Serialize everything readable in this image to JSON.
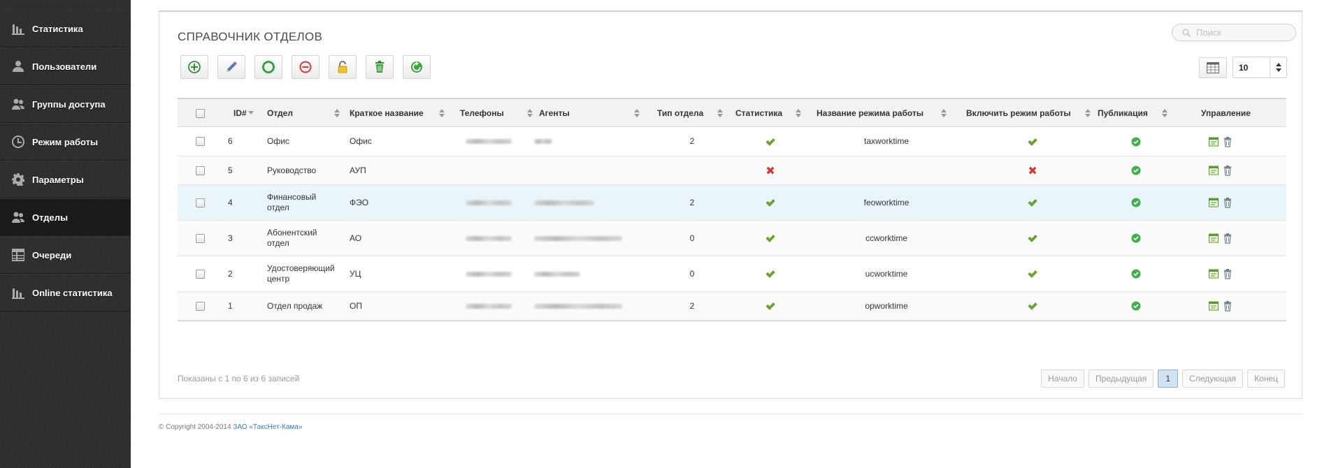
{
  "sidebar": {
    "items": [
      {
        "label": "Статистика",
        "icon": "bar-chart-icon"
      },
      {
        "label": "Пользователи",
        "icon": "user-icon"
      },
      {
        "label": "Группы доступа",
        "icon": "users-group-icon"
      },
      {
        "label": "Режим работы",
        "icon": "clock-icon"
      },
      {
        "label": "Параметры",
        "icon": "gear-icon"
      },
      {
        "label": "Отделы",
        "icon": "users-group-icon",
        "active": true
      },
      {
        "label": "Очереди",
        "icon": "table-icon"
      },
      {
        "label": "Online статистика",
        "icon": "bar-chart-icon"
      }
    ]
  },
  "main": {
    "title": "СПРАВОЧНИК ОТДЕЛОВ",
    "search_placeholder": "Поиск",
    "page_size": "10",
    "toolbar": [
      "add-circle-icon",
      "pencil-icon",
      "enable-circle-icon",
      "disable-circle-icon",
      "lock-icon",
      "trash-icon",
      "refresh-icon"
    ],
    "columns": {
      "id": "ID#",
      "dept": "Отдел",
      "short": "Краткое название",
      "phones": "Телефоны",
      "agents": "Агенты",
      "type": "Тип отдела",
      "stats": "Статистика",
      "mode_name": "Название режима работы",
      "mode_on": "Включить режим работы",
      "pub": "Публикация",
      "manage": "Управление"
    },
    "rows": [
      {
        "id": "6",
        "dept": "Офис",
        "short": "Офис",
        "type": "2",
        "stats": "yes",
        "mode_name": "taxworktime",
        "mode_on": "yes",
        "pub": "yes"
      },
      {
        "id": "5",
        "dept": "Руководство",
        "short": "АУП",
        "type": "",
        "stats": "no",
        "mode_name": "",
        "mode_on": "no",
        "pub": "yes"
      },
      {
        "id": "4",
        "dept": "Финансовый отдел",
        "short": "ФЭО",
        "type": "2",
        "stats": "yes",
        "mode_name": "feoworktime",
        "mode_on": "yes",
        "pub": "yes"
      },
      {
        "id": "3",
        "dept": "Абонентский отдел",
        "short": "АО",
        "type": "0",
        "stats": "yes",
        "mode_name": "ccworktime",
        "mode_on": "yes",
        "pub": "yes"
      },
      {
        "id": "2",
        "dept": "Удостоверяющий центр",
        "short": "УЦ",
        "type": "0",
        "stats": "yes",
        "mode_name": "ucworktime",
        "mode_on": "yes",
        "pub": "yes"
      },
      {
        "id": "1",
        "dept": "Отдел продаж",
        "short": "ОП",
        "type": "2",
        "stats": "yes",
        "mode_name": "opworktime",
        "mode_on": "yes",
        "pub": "yes"
      }
    ],
    "info": "Показаны с 1 по 6 из 6 записей",
    "pager": {
      "first": "Начало",
      "prev": "Предыдущая",
      "current": "1",
      "next": "Следующая",
      "last": "Конец"
    }
  },
  "footer": {
    "copyright": "© Copyright 2004-2014",
    "company": "ЗАО «ТаксНет-Кама»"
  },
  "colors": {
    "sidebar_bg": "#2f2f2f",
    "check_green": "#6aaa2a",
    "cross_red": "#e0332b",
    "highlight_row": "#e9f4fb"
  }
}
